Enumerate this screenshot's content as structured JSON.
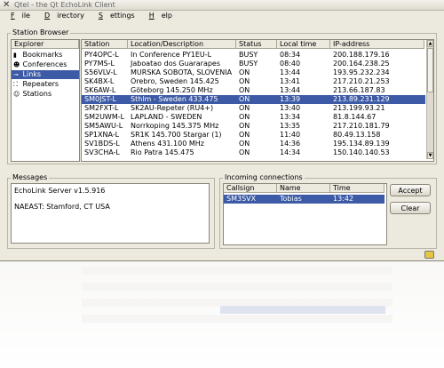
{
  "window": {
    "title": "Qtel - the Qt EchoLink Client",
    "menu": [
      {
        "first": "F",
        "rest": "ile"
      },
      {
        "first": "D",
        "rest": "irectory"
      },
      {
        "first": "S",
        "rest": "ettings"
      },
      {
        "first": "H",
        "rest": "elp"
      }
    ]
  },
  "station_browser": {
    "title": "Station Browser",
    "explorer": {
      "header": "Explorer",
      "items": [
        {
          "label": "Bookmarks",
          "icon": "bookmark-icon"
        },
        {
          "label": "Conferences",
          "icon": "conference-icon"
        },
        {
          "label": "Links",
          "icon": "link-icon",
          "selected": true
        },
        {
          "label": "Repeaters",
          "icon": "repeater-icon"
        },
        {
          "label": "Stations",
          "icon": "station-icon"
        }
      ]
    },
    "columns": [
      "Station",
      "Location/Description",
      "Status",
      "Local time",
      "IP-address"
    ],
    "rows": [
      [
        "PY4OPC-L",
        "In Conference PY1EU-L",
        "BUSY",
        "08:34",
        "200.188.179.16"
      ],
      [
        "PY7MS-L",
        "Jaboatao dos Guararapes",
        "BUSY",
        "08:40",
        "200.164.238.25"
      ],
      [
        "S56VLV-L",
        "MURSKA SOBOTA, SLOVENIA",
        "ON",
        "13:44",
        "193.95.232.234"
      ],
      [
        "SK4BX-L",
        "Örebro, Sweden 145.425",
        "ON",
        "13:41",
        "217.210.21.253"
      ],
      [
        "SK6AW-L",
        "Göteborg 145.250 MHz",
        "ON",
        "13:44",
        "213.66.187.83"
      ],
      [
        "SM0JST-L",
        "Sthlm - Sweden 433.475",
        "ON",
        "13:39",
        "213.89.231.129"
      ],
      [
        "SM2FXT-L",
        "SK2AU-Repeter (RU4+)",
        "ON",
        "13:40",
        "213.199.93.21"
      ],
      [
        "SM2UWM-L",
        "LAPLAND - SWEDEN",
        "ON",
        "13:34",
        "81.8.144.67"
      ],
      [
        "SM5AWU-L",
        "Norrkoping 145.375 MHz",
        "ON",
        "13:35",
        "217.210.181.79"
      ],
      [
        "SP1XNA-L",
        "SR1K 145.700 Stargar (1)",
        "ON",
        "11:40",
        "80.49.13.158"
      ],
      [
        "SV1BDS-L",
        "Athens 431.100 MHz",
        "ON",
        "14:36",
        "195.134.89.139"
      ],
      [
        "SV3CHA-L",
        "Rio Patra 145.475",
        "ON",
        "14:34",
        "150.140.140.53"
      ]
    ],
    "selected_row": 5
  },
  "messages": {
    "title": "Messages",
    "lines": [
      "EchoLink Server v1.5.916",
      "",
      "NAEAST: Stamford, CT USA"
    ]
  },
  "incoming": {
    "title": "Incoming connections",
    "columns": [
      "Callsign",
      "Name",
      "Time"
    ],
    "rows": [
      [
        "SM3SVX",
        "Tobias",
        "13:42"
      ]
    ],
    "accept_label": "Accept",
    "clear_label": "Clear"
  },
  "colors": {
    "selection": "#3c5aa5",
    "window_bg": "#ece9df"
  }
}
